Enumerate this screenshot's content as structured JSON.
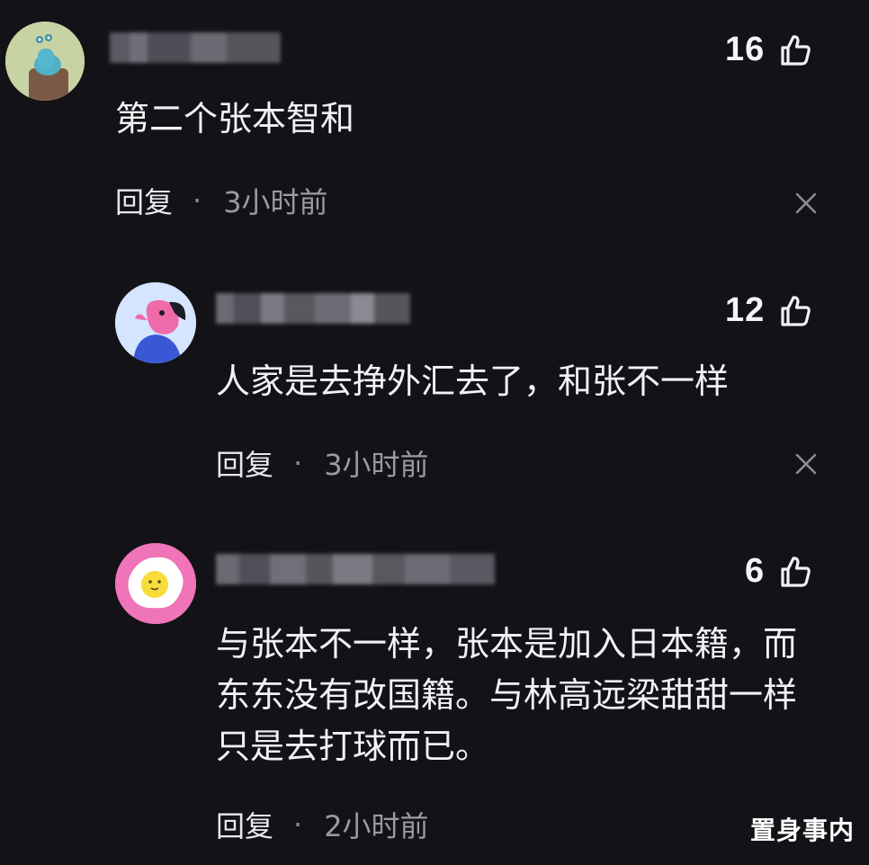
{
  "comments": [
    {
      "likes": "16",
      "content_lines": [
        "第二个张本智和"
      ],
      "reply_label": "回复",
      "separator": "·",
      "time": "3小时前"
    },
    {
      "likes": "12",
      "content_lines": [
        "人家是去挣外汇去了，和张不一样"
      ],
      "reply_label": "回复",
      "separator": "·",
      "time": "3小时前"
    },
    {
      "likes": "6",
      "content_lines": [
        "与张本不一样，张本是加入日本籍，而",
        "东东没有改国籍。与林高远梁甜甜一样",
        "只是去打球而已。"
      ],
      "reply_label": "回复",
      "separator": "·",
      "time": "2小时前"
    }
  ],
  "watermark": "置身事内",
  "colors": {
    "background": "#121217",
    "text": "#f2f2f4",
    "meta": "#9a9aa0"
  }
}
